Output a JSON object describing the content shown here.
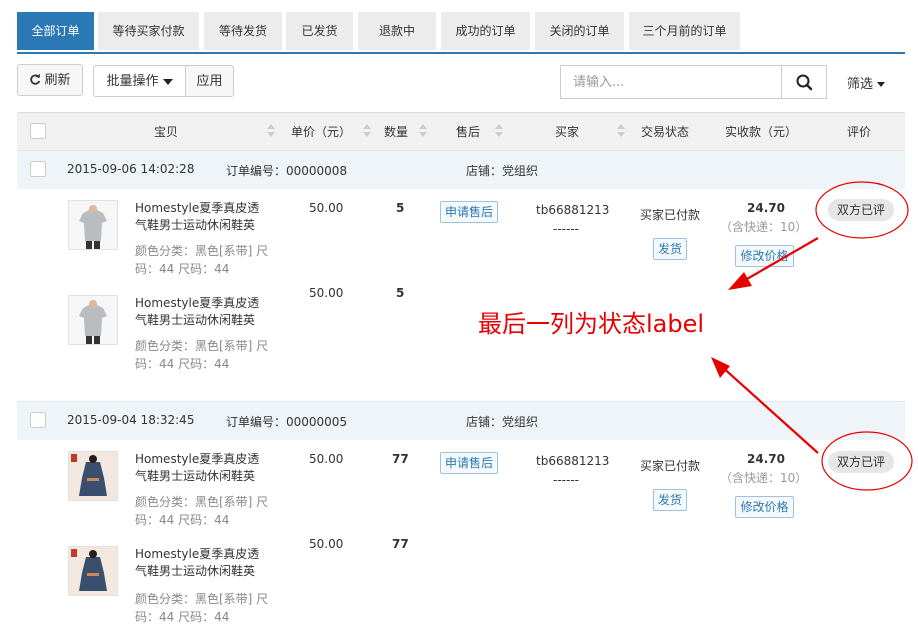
{
  "tabs": [
    {
      "label": "全部订单",
      "active": true
    },
    {
      "label": "等待买家付款",
      "active": false
    },
    {
      "label": "等待发货",
      "active": false
    },
    {
      "label": "已发货",
      "active": false
    },
    {
      "label": "退款中",
      "active": false
    },
    {
      "label": "成功的订单",
      "active": false
    },
    {
      "label": "关闭的订单",
      "active": false
    },
    {
      "label": "三个月前的订单",
      "active": false
    }
  ],
  "toolbar": {
    "refresh_label": "刷新",
    "batch_label": "批量操作",
    "apply_label": "应用",
    "search_placeholder": "请输入...",
    "filter_label": "筛选"
  },
  "columns": [
    "宝贝",
    "单价（元）",
    "数量",
    "售后",
    "买家",
    "交易状态",
    "实收款（元）",
    "评价"
  ],
  "orders": [
    {
      "time": "2015-09-06 14:02:28",
      "order_no": "订单编号：00000008",
      "shop": "店铺：党组织",
      "buyer": "tb66881213",
      "buyer_sub": "------",
      "status": "买家已付款",
      "ship_label": "发货",
      "aftersale_label": "申请售后",
      "total": "24.70",
      "total_note": "（含快递：10）",
      "modify_label": "修改价格",
      "eval_label": "双方已评",
      "items": [
        {
          "name": "Homestyle夏季真皮透气鞋男士运动休闲鞋英",
          "attr": "颜色分类：黑色[系带]  尺码：44  尺码：44",
          "price": "50.00",
          "qty": "5"
        },
        {
          "name": "Homestyle夏季真皮透气鞋男士运动休闲鞋英",
          "attr": "颜色分类：黑色[系带]  尺码：44  尺码：44",
          "price": "50.00",
          "qty": "5"
        }
      ]
    },
    {
      "time": "2015-09-04 18:32:45",
      "order_no": "订单编号：00000005",
      "shop": "店铺：党组织",
      "buyer": "tb66881213",
      "buyer_sub": "------",
      "status": "买家已付款",
      "ship_label": "发货",
      "aftersale_label": "申请售后",
      "total": "24.70",
      "total_note": "（含快递：10）",
      "modify_label": "修改价格",
      "eval_label": "双方已评",
      "items": [
        {
          "name": "Homestyle夏季真皮透气鞋男士运动休闲鞋英",
          "attr": "颜色分类：黑色[系带]  尺码：44  尺码：44",
          "price": "50.00",
          "qty": "77"
        },
        {
          "name": "Homestyle夏季真皮透气鞋男士运动休闲鞋英",
          "attr": "颜色分类：黑色[系带]  尺码：44  尺码：44",
          "price": "50.00",
          "qty": "77"
        }
      ]
    }
  ],
  "annotation": {
    "text": "最后一列为状态label",
    "color": "#e60000"
  },
  "colors": {
    "primary": "#2b79b4",
    "annotation": "#e60000"
  }
}
